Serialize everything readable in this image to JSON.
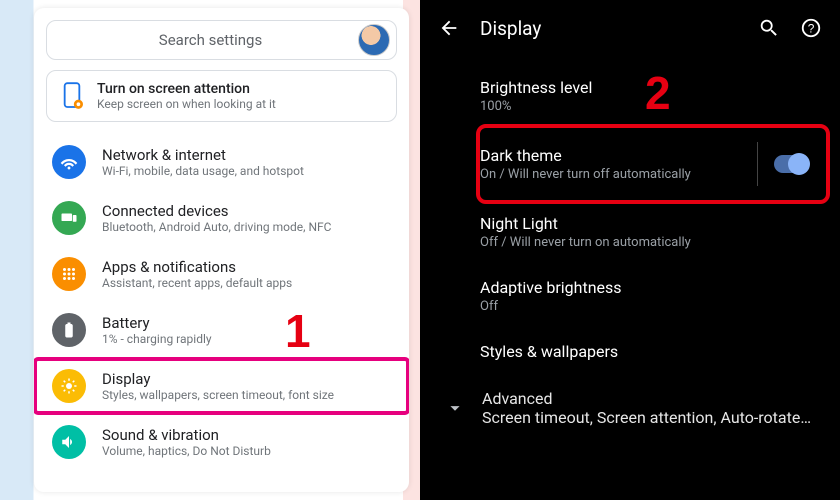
{
  "left": {
    "search_placeholder": "Search settings",
    "attention": {
      "title": "Turn on screen attention",
      "subtitle": "Keep screen on when looking at it"
    },
    "items": [
      {
        "title": "Network & internet",
        "subtitle": "Wi-Fi, mobile, data usage, and hotspot"
      },
      {
        "title": "Connected devices",
        "subtitle": "Bluetooth, Android Auto, driving mode, NFC"
      },
      {
        "title": "Apps & notifications",
        "subtitle": "Assistant, recent apps, default apps"
      },
      {
        "title": "Battery",
        "subtitle": "1% - charging rapidly"
      },
      {
        "title": "Display",
        "subtitle": "Styles, wallpapers, screen timeout, font size"
      },
      {
        "title": "Sound & vibration",
        "subtitle": "Volume, haptics, Do Not Disturb"
      }
    ]
  },
  "right": {
    "header_title": "Display",
    "items": {
      "brightness": {
        "title": "Brightness level",
        "subtitle": "100%"
      },
      "darktheme": {
        "title": "Dark theme",
        "subtitle": "On / Will never turn off automatically",
        "toggle_on": true
      },
      "nightlight": {
        "title": "Night Light",
        "subtitle": "Off / Will never turn on automatically"
      },
      "adaptive": {
        "title": "Adaptive brightness",
        "subtitle": "Off"
      },
      "styles": {
        "title": "Styles & wallpapers"
      },
      "advanced": {
        "title": "Advanced",
        "subtitle": "Screen timeout, Screen attention, Auto-rotate s.."
      }
    }
  },
  "steps": {
    "one": "1",
    "two": "2"
  }
}
